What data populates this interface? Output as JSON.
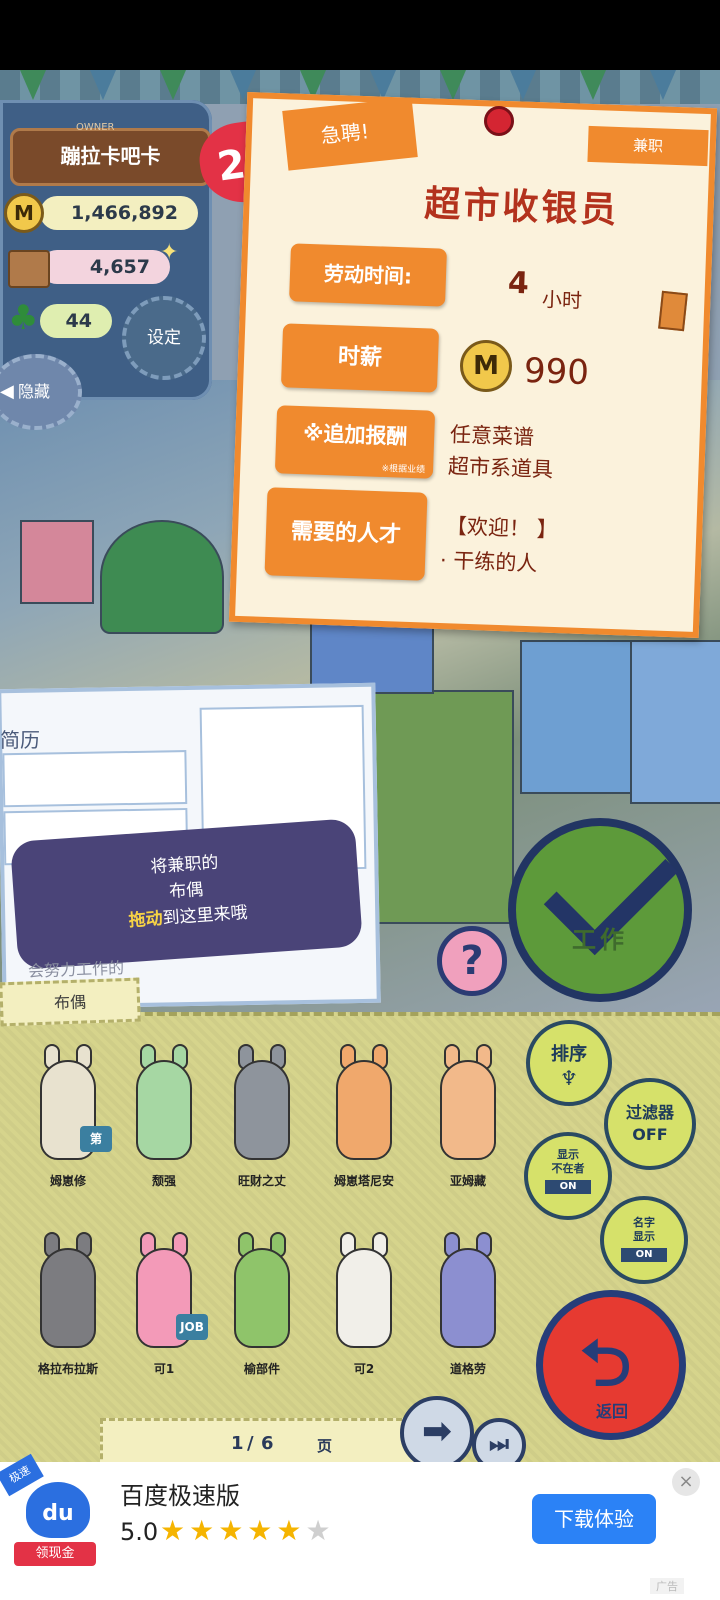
{
  "owner": {
    "shop_name": "蹦拉卡吧卡",
    "owner_tag": "OWNER",
    "level": "28",
    "coins": "1,466,892",
    "coin_icon_letter": "M",
    "inventory": "4,657",
    "clover": "44",
    "settings_label": "设定",
    "hide_label": "隐藏"
  },
  "job": {
    "urgent_label": "急聘!",
    "type_label": "兼职",
    "title": "超市收银员",
    "hours_label": "劳动时间:",
    "hours_value": "4",
    "hours_unit": "小时",
    "wage_label": "时薪",
    "wage_value": "990",
    "bonus_label": "※追加报酬",
    "bonus_note": "※根据业绩",
    "bonus_values": [
      "任意菜谱",
      "超市系道具"
    ],
    "talent_label": "需要的人才",
    "talent_values": [
      "【欢迎！ 】",
      "· 干练的人"
    ]
  },
  "resume": {
    "title": "简历",
    "hint_line1": "将兼职的",
    "hint_line2": "布偶",
    "hint_highlight": "拖动",
    "hint_line3_rest": "到这里来哦",
    "footer": "会努力工作的"
  },
  "actions": {
    "help_label": "?",
    "work_label": "工作"
  },
  "tray": {
    "tab_label": "布偶",
    "dolls": [
      {
        "name": "姆崽修",
        "color": "#e8e2cf",
        "badge": "第"
      },
      {
        "name": "颓强",
        "color": "#a6d7a3"
      },
      {
        "name": "旺财之丈",
        "color": "#8e949c"
      },
      {
        "name": "姆崽塔尼安",
        "color": "#f0a86c"
      },
      {
        "name": "亚姆藏",
        "color": "#f2b98a"
      },
      {
        "name": "格拉布拉斯",
        "color": "#7c7c80"
      },
      {
        "name": "可1",
        "color": "#f39ab8",
        "badge": "JOB"
      },
      {
        "name": "榆部件",
        "color": "#8fc46a"
      },
      {
        "name": "可2",
        "color": "#f1efe9"
      },
      {
        "name": "道格劳",
        "color": "#8c8fd0"
      }
    ],
    "sort_label": "排序",
    "filter_label": "过滤器",
    "filter_state": "OFF",
    "absent_label_1": "显示",
    "absent_label_2": "不在者",
    "absent_toggle": "ON",
    "name_label_1": "名字",
    "name_label_2": "显示",
    "name_toggle": "ON",
    "return_label": "返回",
    "page_current": "1",
    "page_total": "6",
    "page_sep": "/",
    "page_unit": "页"
  },
  "ad": {
    "title": "百度极速版",
    "rating": "5.0",
    "stars_filled": "★★★★★",
    "stars_empty": "★",
    "button": "下载体验",
    "logo_text": "du",
    "logo_sub": "领现金",
    "logo_corner": "极速",
    "ad_tag": "广告",
    "close": "×"
  }
}
